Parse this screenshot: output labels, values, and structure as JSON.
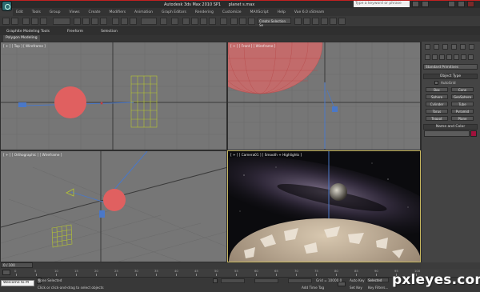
{
  "window": {
    "title_app": "Autodesk 3ds Max 2010 SP1",
    "title_file": "planet s.max",
    "search_placeholder": "Type a keyword or phrase"
  },
  "menubar": [
    "Edit",
    "Tools",
    "Group",
    "Views",
    "Create",
    "Modifiers",
    "Animation",
    "Graph Editors",
    "Rendering",
    "Customize",
    "MAXScript",
    "Help",
    "Vue 6.0 xStream"
  ],
  "toolbar": {
    "selection_set": "Create Selection Se"
  },
  "ribbon": {
    "tabs": [
      "Graphite Modeling Tools",
      "Freeform",
      "Selection"
    ],
    "sub_tab": "Polygon Modeling"
  },
  "viewports": {
    "top": "[ + ] [ Top ] [ Wireframe ]",
    "front": "[ + ] [ Front ] [ Wireframe ]",
    "ortho": "[ + ] [ Orthographic ] [ Wireframe ]",
    "camera": "[ + ] [ Camera01 ] [ Smooth + Highlights ]"
  },
  "command_panel": {
    "category": "Standard Primitives",
    "object_type_header": "Object Type",
    "autogrid": "AutoGrid",
    "buttons": [
      [
        "Box",
        "Cone"
      ],
      [
        "Sphere",
        "GeoSphere"
      ],
      [
        "Cylinder",
        "Tube"
      ],
      [
        "Torus",
        "Pyramid"
      ],
      [
        "Teapot",
        "Plane"
      ]
    ],
    "name_color_header": "Name and Color",
    "object_color": "#a0123c"
  },
  "timeline": {
    "slider": "0 / 100",
    "ticks": [
      "0",
      "5",
      "10",
      "15",
      "20",
      "25",
      "30",
      "35",
      "40",
      "45",
      "50",
      "55",
      "60",
      "65",
      "70",
      "75",
      "80",
      "85",
      "90",
      "95",
      "100"
    ]
  },
  "status": {
    "maxscript": "Welcome to M",
    "selected": "None Selected",
    "prompt": "Click or click-and-drag to select objects",
    "grid": "Grid = 10000.0",
    "add_time_tag": "Add Time Tag",
    "auto_key": "Auto Key",
    "set_key": "Set Key",
    "key_filters": "Key Filters...",
    "selected_drop": "Selected"
  },
  "watermark": "pxleyes.com"
}
